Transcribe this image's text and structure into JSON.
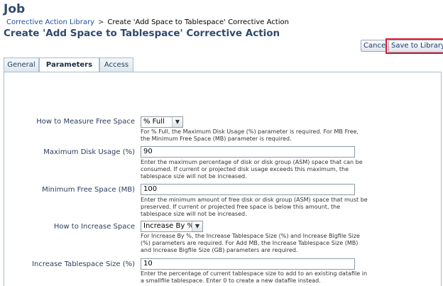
{
  "app": {
    "title": "Job"
  },
  "breadcrumb": {
    "link": "Corrective Action Library",
    "separator": ">",
    "current": "Create 'Add Space to Tablespace' Corrective Action"
  },
  "heading": "Create 'Add Space to Tablespace' Corrective Action",
  "buttons": {
    "cancel": "Cancel",
    "save": "Save to Library"
  },
  "tabs": [
    {
      "label": "General",
      "active": false
    },
    {
      "label": "Parameters",
      "active": true
    },
    {
      "label": "Access",
      "active": false
    }
  ],
  "fields": [
    {
      "label": "How to Measure Free Space",
      "type": "select",
      "value": "% Full",
      "help": "For % Full, the Maximum Disk Usage (%) parameter is required. For MB Free, the Minimum Free Space (MB) parameter is required."
    },
    {
      "label": "Maximum Disk Usage (%)",
      "type": "text",
      "value": "90",
      "help": "Enter the maximum percentage of disk or disk group (ASM) space that can be consumed. If current or projected disk usage exceeds this maximum, the tablespace size will not be increased."
    },
    {
      "label": "Minimum Free Space (MB)",
      "type": "text",
      "value": "100",
      "help": "Enter the minimum amount of free disk or disk group (ASM) space that must be preserved. If current or projected free space is below this amount, the tablespace size will not be increased."
    },
    {
      "label": "How to Increase Space",
      "type": "select",
      "value": "Increase By %",
      "help": "For Increase By %, the Increase Tablespace Size (%) and Increase Bigfile Size (%) parameters are required. For Add MB, the Increase Tablespace Size (MB) and Increase Bigfile Size (GB) parameters are required."
    },
    {
      "label": "Increase Tablespace Size (%)",
      "type": "text",
      "value": "10",
      "help": "Enter the percentage of current tablespace size to add to an existing datafile in a smallfile tablespace. Enter 0 to create a new datafile instead."
    }
  ],
  "colors": {
    "accent": "#2f4a6e",
    "link": "#1f4fa3",
    "highlight": "#e0182d"
  }
}
